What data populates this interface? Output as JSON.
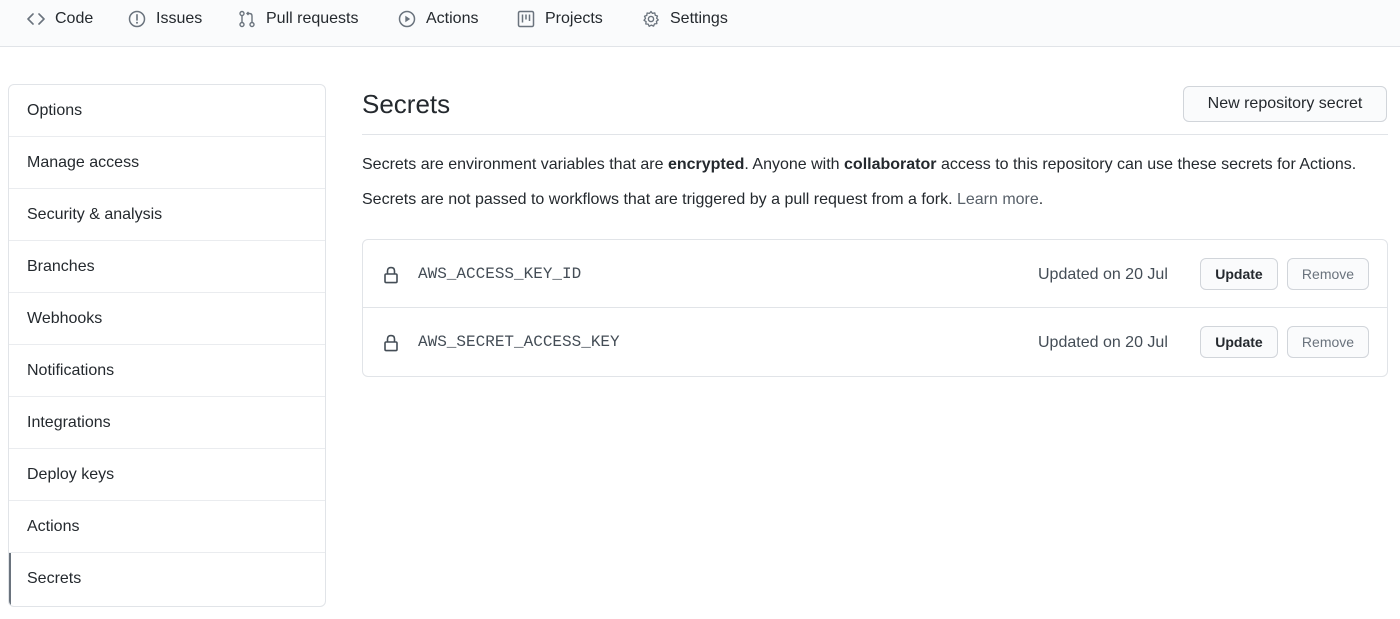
{
  "nav": {
    "items": [
      {
        "label": "Code",
        "icon": "code-icon"
      },
      {
        "label": "Issues",
        "icon": "issue-icon"
      },
      {
        "label": "Pull requests",
        "icon": "pull-request-icon"
      },
      {
        "label": "Actions",
        "icon": "play-icon"
      },
      {
        "label": "Projects",
        "icon": "project-icon"
      },
      {
        "label": "Settings",
        "icon": "gear-icon"
      }
    ]
  },
  "sidebar": {
    "items": [
      {
        "label": "Options"
      },
      {
        "label": "Manage access"
      },
      {
        "label": "Security & analysis"
      },
      {
        "label": "Branches"
      },
      {
        "label": "Webhooks"
      },
      {
        "label": "Notifications"
      },
      {
        "label": "Integrations"
      },
      {
        "label": "Deploy keys"
      },
      {
        "label": "Actions"
      },
      {
        "label": "Secrets",
        "selected": true
      }
    ]
  },
  "main": {
    "title": "Secrets",
    "new_button_label": "New repository secret",
    "description_1": {
      "part1": "Secrets are environment variables that are ",
      "bold1": "encrypted",
      "part2": ". Anyone with ",
      "bold2": "collaborator",
      "part3": " access to this repository can use these secrets for Actions."
    },
    "description_2": {
      "text": "Secrets are not passed to workflows that are triggered by a pull request from a fork. ",
      "link": "Learn more",
      "end": "."
    },
    "secrets": [
      {
        "name": "AWS_ACCESS_KEY_ID",
        "updated": "Updated on 20 Jul",
        "update_label": "Update",
        "remove_label": "Remove"
      },
      {
        "name": "AWS_SECRET_ACCESS_KEY",
        "updated": "Updated on 20 Jul",
        "update_label": "Update",
        "remove_label": "Remove"
      }
    ]
  },
  "colors": {
    "nav_background": "#fafbfc",
    "border": "#e1e4e8",
    "text": "#24292e",
    "muted_text": "#586069",
    "selected_marker": "#6a737d"
  }
}
